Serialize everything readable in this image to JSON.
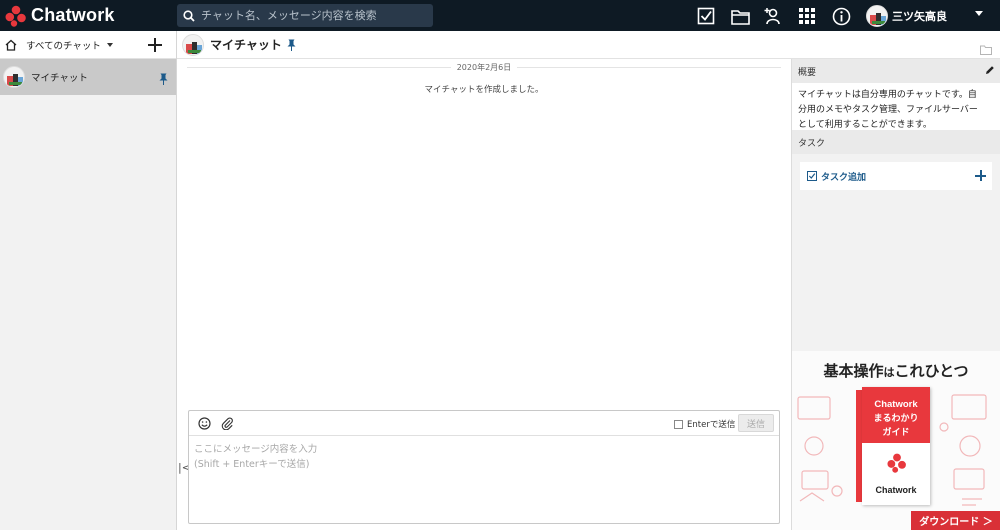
{
  "header": {
    "brand": "Chatwork",
    "search_placeholder": "チャット名、メッセージ内容を検索",
    "user_name": "三ツ矢高良"
  },
  "sidebar": {
    "filter_label": "すべてのチャット",
    "rooms": [
      {
        "name": "マイチャット"
      }
    ]
  },
  "chat": {
    "title": "マイチャット",
    "date_divider": "2020年2月6日",
    "system_message": "マイチャットを作成しました。",
    "composer": {
      "enter_option_label": "Enterで送信",
      "send_label": "送信",
      "placeholder_line1": "ここにメッセージ内容を入力",
      "placeholder_line2": "(Shift + Enterキーで送信)"
    }
  },
  "right_panel": {
    "summary_heading": "概要",
    "summary_line1": "マイチャットは自分専用のチャットです。自",
    "summary_line2": "分用のメモやタスク管理、ファイルサーバー",
    "summary_line3": "として利用することができます。",
    "task_heading": "タスク",
    "add_task_label": "タスク追加"
  },
  "promo": {
    "title_main": "基本操作",
    "title_particle": "は",
    "title_end": "これひとつ",
    "book_line1": "Chatwork",
    "book_line2": "まるわかり",
    "book_line3": "ガイド",
    "book_brand": "Chatwork",
    "download_label": "ダウンロード ＞"
  },
  "colors": {
    "header_bg": "#0e1a24",
    "brand_red": "#e8383d",
    "link_blue": "#1c5a8a"
  }
}
